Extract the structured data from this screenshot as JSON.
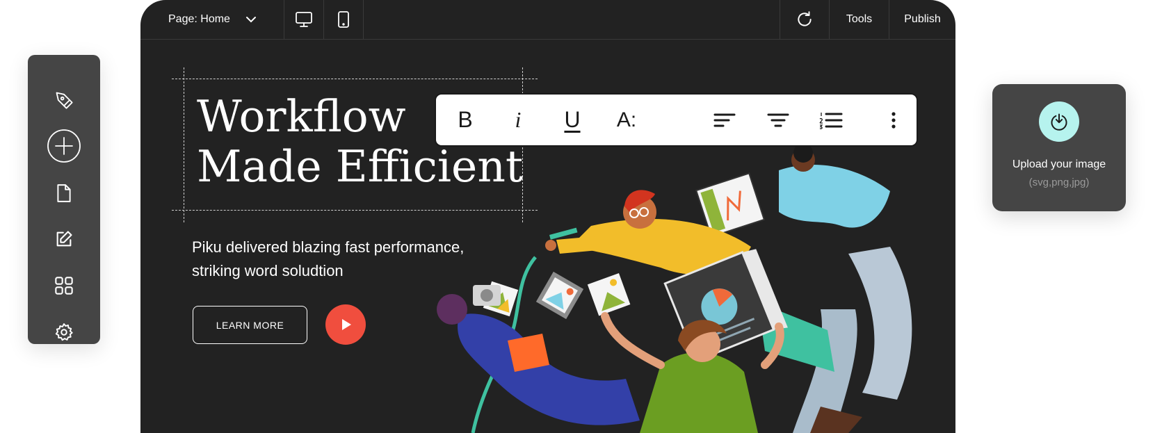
{
  "topbar": {
    "page_label": "Page: Home",
    "tools_label": "Tools",
    "publish_label": "Publish"
  },
  "format_toolbar": {
    "bold": "B",
    "italic": "i",
    "underline": "U",
    "font_size": "A:"
  },
  "hero": {
    "title_line1": "Workflow",
    "title_line2": "Made Efficient",
    "subtitle": "Piku delivered blazing fast performance, striking word soludtion",
    "cta_label": "LEARN MORE"
  },
  "upload": {
    "title": "Upload your image",
    "formats": "(svg,png,jpg)"
  },
  "sidebar": {
    "items": [
      "pen-tool-icon",
      "add-icon",
      "page-icon",
      "edit-icon",
      "grid-icon",
      "settings-icon"
    ]
  },
  "colors": {
    "editor_bg": "#222222",
    "panel_bg": "#454545",
    "play_button": "#f04e3e",
    "upload_accent": "#b6f3ee"
  }
}
